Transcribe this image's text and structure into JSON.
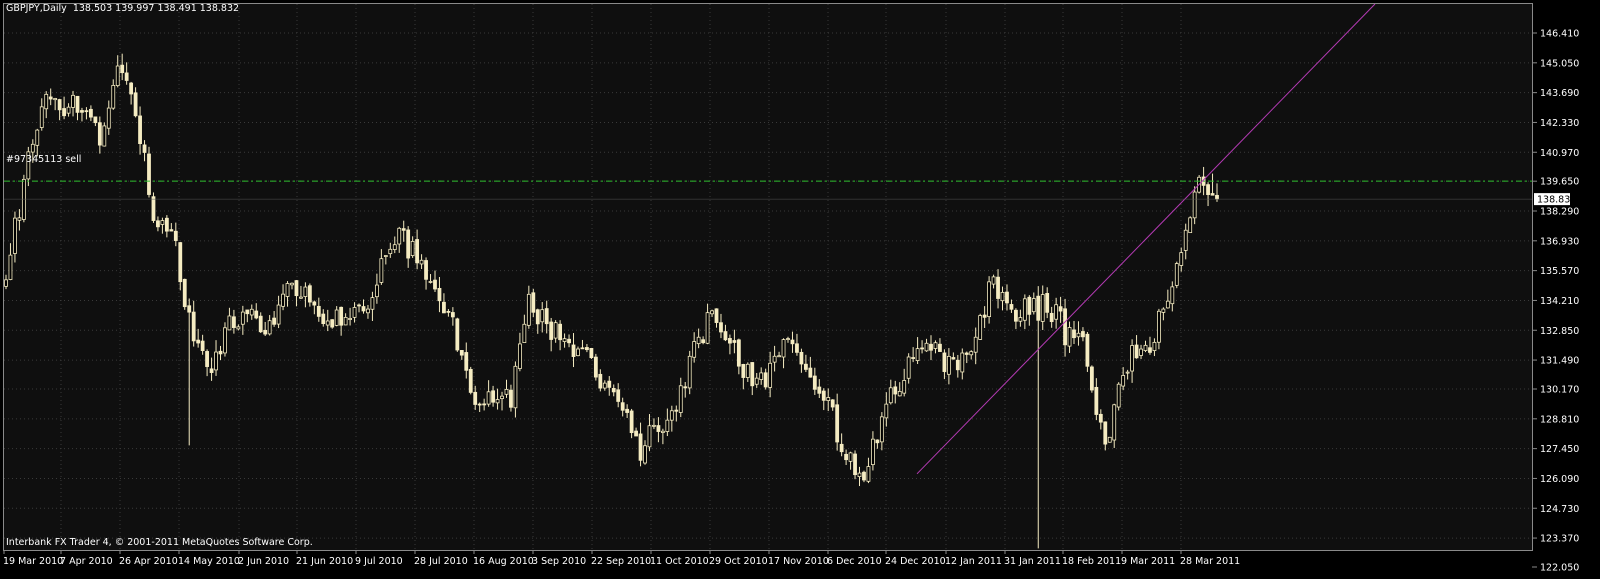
{
  "header": {
    "symbol_timeframe": "GBPJPY,Daily",
    "ohlc": "138.503 139.997 138.491 138.832"
  },
  "footer": {
    "copyright": "Interbank FX Trader 4, © 2001-2011 MetaQuotes Software Corp."
  },
  "order_line": {
    "label": "#97345113 sell",
    "price": 139.65,
    "color": "#2fbf2f"
  },
  "current_price": {
    "label": "138.832",
    "value": 138.832
  },
  "colors": {
    "background": "#0f0f0f",
    "candles": "#f5ecc2",
    "grid": "#3a3a3a",
    "trendline": "#b33ab3",
    "axis_text": "#ffffff"
  },
  "chart_data": {
    "type": "candlestick",
    "title": "GBPJPY,Daily",
    "xlabel": "",
    "ylabel": "",
    "ylim": [
      122.05,
      146.41
    ],
    "grid": true,
    "y_ticks": [
      "146.410",
      "145.050",
      "143.690",
      "142.330",
      "140.970",
      "139.650",
      "138.290",
      "136.930",
      "135.570",
      "134.210",
      "132.850",
      "131.490",
      "130.170",
      "128.810",
      "127.450",
      "126.090",
      "124.730",
      "123.370",
      "122.050"
    ],
    "x_ticks": [
      "19 Mar 2010",
      "7 Apr 2010",
      "26 Apr 2010",
      "14 May 2010",
      "2 Jun 2010",
      "21 Jun 2010",
      "9 Jul 2010",
      "28 Jul 2010",
      "16 Aug 2010",
      "3 Sep 2010",
      "22 Sep 2010",
      "11 Oct 2010",
      "29 Oct 2010",
      "17 Nov 2010",
      "6 Dec 2010",
      "24 Dec 2010",
      "12 Jan 2011",
      "31 Jan 2011",
      "18 Feb 2011",
      "9 Mar 2011",
      "28 Mar 2011"
    ],
    "approx_closes": [
      {
        "date": "19 Mar 2010",
        "close": 135.8
      },
      {
        "date": "26 Mar 2010",
        "close": 139.5
      },
      {
        "date": "1 Apr 2010",
        "close": 143.9
      },
      {
        "date": "7 Apr 2010",
        "close": 142.8
      },
      {
        "date": "14 Apr 2010",
        "close": 143.5
      },
      {
        "date": "20 Apr 2010",
        "close": 141.6
      },
      {
        "date": "26 Apr 2010",
        "close": 144.6
      },
      {
        "date": "30 Apr 2010",
        "close": 142.8
      },
      {
        "date": "5 May 2010",
        "close": 137.5
      },
      {
        "date": "10 May 2010",
        "close": 136.9
      },
      {
        "date": "14 May 2010",
        "close": 132.5
      },
      {
        "date": "20 May 2010",
        "close": 130.6
      },
      {
        "date": "26 May 2010",
        "close": 133.0
      },
      {
        "date": "2 Jun 2010",
        "close": 134.0
      },
      {
        "date": "8 Jun 2010",
        "close": 133.0
      },
      {
        "date": "14 Jun 2010",
        "close": 134.5
      },
      {
        "date": "21 Jun 2010",
        "close": 134.5
      },
      {
        "date": "29 Jun 2010",
        "close": 133.2
      },
      {
        "date": "9 Jul 2010",
        "close": 133.5
      },
      {
        "date": "16 Jul 2010",
        "close": 133.4
      },
      {
        "date": "23 Jul 2010",
        "close": 135.5
      },
      {
        "date": "28 Jul 2010",
        "close": 136.9
      },
      {
        "date": "3 Aug 2010",
        "close": 136.5
      },
      {
        "date": "10 Aug 2010",
        "close": 134.5
      },
      {
        "date": "16 Aug 2010",
        "close": 133.0
      },
      {
        "date": "24 Aug 2010",
        "close": 130.0
      },
      {
        "date": "30 Aug 2010",
        "close": 129.6
      },
      {
        "date": "3 Sep 2010",
        "close": 129.5
      },
      {
        "date": "9 Sep 2010",
        "close": 134.0
      },
      {
        "date": "16 Sep 2010",
        "close": 133.2
      },
      {
        "date": "22 Sep 2010",
        "close": 132.6
      },
      {
        "date": "30 Sep 2010",
        "close": 131.5
      },
      {
        "date": "6 Oct 2010",
        "close": 130.6
      },
      {
        "date": "11 Oct 2010",
        "close": 129.7
      },
      {
        "date": "18 Oct 2010",
        "close": 127.5
      },
      {
        "date": "25 Oct 2010",
        "close": 128.5
      },
      {
        "date": "29 Oct 2010",
        "close": 129.6
      },
      {
        "date": "5 Nov 2010",
        "close": 132.0
      },
      {
        "date": "11 Nov 2010",
        "close": 133.8
      },
      {
        "date": "17 Nov 2010",
        "close": 132.0
      },
      {
        "date": "24 Nov 2010",
        "close": 130.6
      },
      {
        "date": "30 Nov 2010",
        "close": 130.7
      },
      {
        "date": "6 Dec 2010",
        "close": 132.8
      },
      {
        "date": "13 Dec 2010",
        "close": 131.5
      },
      {
        "date": "20 Dec 2010",
        "close": 129.6
      },
      {
        "date": "24 Dec 2010",
        "close": 127.4
      },
      {
        "date": "29 Dec 2010",
        "close": 126.0
      },
      {
        "date": "5 Jan 2011",
        "close": 128.8
      },
      {
        "date": "12 Jan 2011",
        "close": 130.5
      },
      {
        "date": "20 Jan 2011",
        "close": 131.9
      },
      {
        "date": "26 Jan 2011",
        "close": 131.7
      },
      {
        "date": "31 Jan 2011",
        "close": 130.8
      },
      {
        "date": "8 Feb 2011",
        "close": 132.6
      },
      {
        "date": "14 Feb 2011",
        "close": 135.0
      },
      {
        "date": "18 Feb 2011",
        "close": 133.9
      },
      {
        "date": "25 Feb 2011",
        "close": 133.9
      },
      {
        "date": "2 Mar 2011",
        "close": 134.0
      },
      {
        "date": "7 Mar 2011",
        "close": 132.6
      },
      {
        "date": "11 Mar 2011",
        "close": 131.8
      },
      {
        "date": "16 Mar 2011",
        "close": 127.0
      },
      {
        "date": "22 Mar 2011",
        "close": 131.6
      },
      {
        "date": "25 Mar 2011",
        "close": 131.5
      },
      {
        "date": "28 Mar 2011",
        "close": 133.5
      },
      {
        "date": "31 Mar 2011",
        "close": 135.8
      },
      {
        "date": "5 Apr 2011",
        "close": 139.3
      },
      {
        "date": "8 Apr 2011",
        "close": 138.8
      }
    ]
  }
}
